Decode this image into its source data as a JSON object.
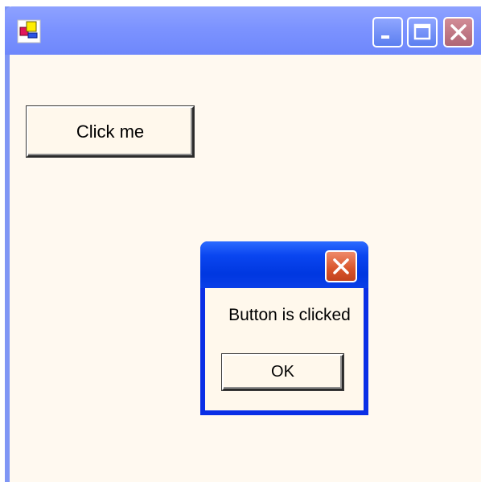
{
  "window": {
    "title": "",
    "icon": "app-icon",
    "controls": [
      "minimize-icon",
      "maximize-icon",
      "close-icon"
    ]
  },
  "main": {
    "button_label": "Click me"
  },
  "dialog": {
    "title": "",
    "message": "Button is clicked",
    "ok_label": "OK",
    "close_icon": "close-icon"
  },
  "colors": {
    "window_titlebar": "#7c93ff",
    "window_background": "#fff9f0",
    "dialog_titlebar": "#0037e0",
    "dialog_close": "#d8542a",
    "window_close": "#b06676"
  }
}
